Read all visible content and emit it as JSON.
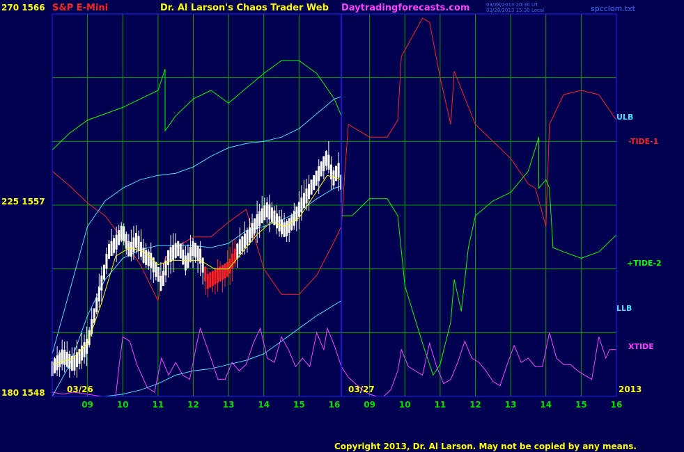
{
  "header": {
    "symbol": "S&P E-Mini",
    "title": "Dr. Al Larson's Chaos Trader Web",
    "site": "Daytradingforecasts.com",
    "stamp1": "03/28/2013 20:30 UT",
    "stamp2": "03/28/2013 15:30 Local",
    "file": "spcclom.txt"
  },
  "copyright": "Copyright 2013, Dr. Al Larson. May not be copied by any means.",
  "colors": {
    "background": "#000050",
    "grid": "#00a000",
    "frame": "#2020ff",
    "tide1": "#ff2020",
    "tide2": "#00ff00",
    "bands": "#40e0ff",
    "xtide": "#ff40ff",
    "price": "#ffffff",
    "ema": "#ffff00"
  },
  "chart_data": {
    "type": "line",
    "y_left_labels": [
      {
        "text": "270  1566",
        "value": 1566
      },
      {
        "text": "225  1557",
        "value": 1557
      },
      {
        "text": "180  1548",
        "value": 1548
      }
    ],
    "ylim": [
      1548,
      1566
    ],
    "x_ticks": [
      "09",
      "10",
      "11",
      "12",
      "13",
      "14",
      "15",
      "16",
      "09",
      "10",
      "11",
      "12",
      "13",
      "14",
      "15",
      "16"
    ],
    "date_labels": [
      "03/26",
      "03/27",
      "2013"
    ],
    "series_labels": [
      {
        "key": "ulb",
        "text": "ULB"
      },
      {
        "key": "tide1",
        "text": "-TIDE-1"
      },
      {
        "key": "tide2",
        "text": "+TIDE-2"
      },
      {
        "key": "llb",
        "text": "LLB"
      },
      {
        "key": "xtide",
        "text": "XTIDE"
      }
    ],
    "series": [
      {
        "key": "tide1",
        "name": "-TIDE-1",
        "color": "#ff2020",
        "points": [
          [
            8.0,
            1558.6
          ],
          [
            8.5,
            1557.9
          ],
          [
            9.0,
            1557.1
          ],
          [
            9.5,
            1556.5
          ],
          [
            10.0,
            1555.4
          ],
          [
            10.5,
            1554.2
          ],
          [
            11.0,
            1552.5
          ],
          [
            11.2,
            1554.5
          ],
          [
            11.5,
            1555.0
          ],
          [
            12.0,
            1555.5
          ],
          [
            12.5,
            1555.5
          ],
          [
            13.0,
            1556.2
          ],
          [
            13.5,
            1556.8
          ],
          [
            14.0,
            1554.0
          ],
          [
            14.5,
            1552.8
          ],
          [
            15.0,
            1552.8
          ],
          [
            15.5,
            1553.7
          ],
          [
            16.0,
            1555.3
          ],
          [
            16.2,
            1556.0
          ],
          [
            16.3,
            1558.6
          ],
          [
            16.4,
            1560.8
          ],
          [
            17.0,
            1560.2
          ],
          [
            17.5,
            1560.2
          ],
          [
            17.8,
            1561.0
          ],
          [
            17.9,
            1564.0
          ],
          [
            18.5,
            1565.8
          ],
          [
            18.7,
            1565.6
          ],
          [
            19.0,
            1563.0
          ],
          [
            19.3,
            1560.8
          ],
          [
            19.4,
            1563.3
          ],
          [
            20.0,
            1560.8
          ],
          [
            21.0,
            1559.2
          ],
          [
            21.5,
            1558.0
          ],
          [
            21.7,
            1557.8
          ],
          [
            22.0,
            1556.0
          ],
          [
            22.1,
            1560.8
          ],
          [
            22.5,
            1562.2
          ],
          [
            23.0,
            1562.4
          ],
          [
            23.5,
            1562.2
          ],
          [
            24.0,
            1561.0
          ]
        ]
      },
      {
        "key": "tide2",
        "name": "+TIDE-2",
        "color": "#00ff00",
        "points": [
          [
            8.0,
            1559.6
          ],
          [
            8.5,
            1560.4
          ],
          [
            9.0,
            1561.0
          ],
          [
            10.0,
            1561.6
          ],
          [
            11.0,
            1562.4
          ],
          [
            11.2,
            1563.4
          ],
          [
            11.2,
            1560.5
          ],
          [
            11.5,
            1561.2
          ],
          [
            12.0,
            1562.0
          ],
          [
            12.5,
            1562.4
          ],
          [
            13.0,
            1561.8
          ],
          [
            13.5,
            1562.5
          ],
          [
            14.0,
            1563.2
          ],
          [
            14.5,
            1563.8
          ],
          [
            15.0,
            1563.8
          ],
          [
            15.5,
            1563.2
          ],
          [
            16.0,
            1562.0
          ],
          [
            16.2,
            1561.2
          ],
          [
            16.2,
            1556.5
          ],
          [
            16.5,
            1556.5
          ],
          [
            17.0,
            1557.3
          ],
          [
            17.5,
            1557.3
          ],
          [
            17.8,
            1556.5
          ],
          [
            18.0,
            1553.2
          ],
          [
            18.5,
            1550.5
          ],
          [
            18.8,
            1549.0
          ],
          [
            19.0,
            1549.5
          ],
          [
            19.3,
            1551.5
          ],
          [
            19.4,
            1553.5
          ],
          [
            19.6,
            1552.0
          ],
          [
            19.8,
            1555.0
          ],
          [
            20.0,
            1556.5
          ],
          [
            20.5,
            1557.2
          ],
          [
            21.0,
            1557.6
          ],
          [
            21.5,
            1558.6
          ],
          [
            21.8,
            1560.2
          ],
          [
            21.8,
            1557.8
          ],
          [
            22.0,
            1558.2
          ],
          [
            22.1,
            1557.8
          ],
          [
            22.2,
            1555.0
          ],
          [
            22.5,
            1554.8
          ],
          [
            23.0,
            1554.5
          ],
          [
            23.5,
            1554.8
          ],
          [
            24.0,
            1555.6
          ]
        ]
      },
      {
        "key": "ulb",
        "name": "ULB",
        "color": "#40e0ff",
        "points": [
          [
            8.0,
            1550.0
          ],
          [
            8.5,
            1553.0
          ],
          [
            9.0,
            1556.0
          ],
          [
            9.5,
            1557.2
          ],
          [
            10.0,
            1557.8
          ],
          [
            10.5,
            1558.2
          ],
          [
            11.0,
            1558.4
          ],
          [
            11.5,
            1558.5
          ],
          [
            12.0,
            1558.8
          ],
          [
            12.5,
            1559.3
          ],
          [
            13.0,
            1559.7
          ],
          [
            13.5,
            1559.9
          ],
          [
            14.0,
            1560.0
          ],
          [
            14.5,
            1560.2
          ],
          [
            15.0,
            1560.6
          ],
          [
            15.5,
            1561.3
          ],
          [
            16.0,
            1562.0
          ],
          [
            16.2,
            1562.1
          ]
        ]
      },
      {
        "key": "mid",
        "name": "",
        "color": "#40e0ff",
        "points": [
          [
            8.0,
            1548.0
          ],
          [
            8.5,
            1549.5
          ],
          [
            9.0,
            1551.8
          ],
          [
            9.5,
            1553.5
          ],
          [
            10.0,
            1554.5
          ],
          [
            10.5,
            1554.9
          ],
          [
            11.0,
            1555.1
          ],
          [
            11.5,
            1555.1
          ],
          [
            12.0,
            1555.1
          ],
          [
            12.5,
            1555.0
          ],
          [
            13.0,
            1555.2
          ],
          [
            13.5,
            1555.8
          ],
          [
            14.0,
            1556.0
          ],
          [
            14.5,
            1556.3
          ],
          [
            15.0,
            1556.7
          ],
          [
            15.5,
            1557.3
          ],
          [
            16.0,
            1557.8
          ],
          [
            16.2,
            1557.9
          ]
        ]
      },
      {
        "key": "llb",
        "name": "LLB",
        "color": "#40e0ff",
        "points": [
          [
            8.0,
            1548.0
          ],
          [
            8.5,
            1548.0
          ],
          [
            9.0,
            1548.0
          ],
          [
            9.5,
            1548.0
          ],
          [
            10.0,
            1548.1
          ],
          [
            10.5,
            1548.3
          ],
          [
            11.0,
            1548.6
          ],
          [
            11.5,
            1549.0
          ],
          [
            12.0,
            1549.2
          ],
          [
            12.5,
            1549.3
          ],
          [
            13.0,
            1549.5
          ],
          [
            13.5,
            1549.7
          ],
          [
            14.0,
            1550.0
          ],
          [
            14.5,
            1550.6
          ],
          [
            15.0,
            1551.2
          ],
          [
            15.5,
            1551.8
          ],
          [
            16.0,
            1552.3
          ],
          [
            16.2,
            1552.5
          ]
        ]
      },
      {
        "key": "xtide",
        "name": "XTIDE",
        "color": "#ff40ff",
        "points": [
          [
            8.0,
            1548.2
          ],
          [
            8.3,
            1548.1
          ],
          [
            8.6,
            1548.2
          ],
          [
            9.0,
            1548.1
          ],
          [
            9.4,
            1548.0
          ],
          [
            9.8,
            1548.0
          ],
          [
            9.9,
            1549.5
          ],
          [
            10.0,
            1550.8
          ],
          [
            10.2,
            1550.6
          ],
          [
            10.4,
            1549.5
          ],
          [
            10.7,
            1548.4
          ],
          [
            10.9,
            1548.2
          ],
          [
            11.1,
            1549.8
          ],
          [
            11.3,
            1549.0
          ],
          [
            11.5,
            1549.6
          ],
          [
            11.7,
            1549.0
          ],
          [
            11.9,
            1548.8
          ],
          [
            12.1,
            1550.5
          ],
          [
            12.2,
            1551.2
          ],
          [
            12.5,
            1549.8
          ],
          [
            12.7,
            1548.8
          ],
          [
            12.9,
            1548.8
          ],
          [
            13.1,
            1549.6
          ],
          [
            13.3,
            1549.2
          ],
          [
            13.5,
            1549.5
          ],
          [
            13.7,
            1550.5
          ],
          [
            13.9,
            1551.2
          ],
          [
            14.1,
            1549.8
          ],
          [
            14.3,
            1549.6
          ],
          [
            14.5,
            1550.8
          ],
          [
            14.7,
            1550.2
          ],
          [
            14.9,
            1549.4
          ],
          [
            15.1,
            1549.8
          ],
          [
            15.3,
            1549.4
          ],
          [
            15.5,
            1551.0
          ],
          [
            15.7,
            1550.2
          ],
          [
            15.8,
            1551.2
          ],
          [
            16.0,
            1550.4
          ],
          [
            16.2,
            1549.4
          ],
          [
            16.4,
            1548.9
          ],
          [
            16.6,
            1548.6
          ],
          [
            16.8,
            1548.3
          ],
          [
            17.0,
            1548.1
          ],
          [
            17.2,
            1548.0
          ],
          [
            17.4,
            1548.0
          ],
          [
            17.6,
            1548.3
          ],
          [
            17.8,
            1549.2
          ],
          [
            17.9,
            1550.2
          ],
          [
            18.1,
            1549.4
          ],
          [
            18.3,
            1549.2
          ],
          [
            18.5,
            1549.0
          ],
          [
            18.7,
            1550.5
          ],
          [
            18.9,
            1549.4
          ],
          [
            19.1,
            1548.6
          ],
          [
            19.3,
            1548.8
          ],
          [
            19.5,
            1549.6
          ],
          [
            19.7,
            1550.6
          ],
          [
            19.9,
            1549.8
          ],
          [
            20.1,
            1549.6
          ],
          [
            20.3,
            1549.2
          ],
          [
            20.5,
            1548.7
          ],
          [
            20.7,
            1548.5
          ],
          [
            20.9,
            1549.5
          ],
          [
            21.1,
            1550.4
          ],
          [
            21.3,
            1549.6
          ],
          [
            21.5,
            1549.8
          ],
          [
            21.7,
            1549.4
          ],
          [
            21.9,
            1549.4
          ],
          [
            22.1,
            1551.0
          ],
          [
            22.3,
            1549.8
          ],
          [
            22.5,
            1549.5
          ],
          [
            22.7,
            1549.5
          ],
          [
            22.9,
            1549.2
          ],
          [
            23.1,
            1549.0
          ],
          [
            23.3,
            1548.8
          ],
          [
            23.5,
            1550.8
          ],
          [
            23.7,
            1549.8
          ],
          [
            23.8,
            1550.2
          ],
          [
            24.0,
            1550.2
          ]
        ]
      }
    ],
    "price_path": [
      [
        8.0,
        1549.3
      ],
      [
        8.3,
        1549.9
      ],
      [
        8.6,
        1549.5
      ],
      [
        9.0,
        1550.4
      ],
      [
        9.3,
        1552.6
      ],
      [
        9.6,
        1554.8
      ],
      [
        9.8,
        1555.2
      ],
      [
        10.0,
        1555.8
      ],
      [
        10.2,
        1554.8
      ],
      [
        10.4,
        1555.4
      ],
      [
        10.6,
        1554.6
      ],
      [
        10.8,
        1554.4
      ],
      [
        11.0,
        1553.8
      ],
      [
        11.1,
        1553.2
      ],
      [
        11.3,
        1554.6
      ],
      [
        11.6,
        1555.0
      ],
      [
        11.8,
        1554.2
      ],
      [
        12.0,
        1555.0
      ],
      [
        12.2,
        1554.6
      ],
      [
        12.4,
        1553.4
      ],
      [
        12.6,
        1553.6
      ],
      [
        12.8,
        1553.8
      ],
      [
        13.0,
        1554.0
      ],
      [
        13.3,
        1555.0
      ],
      [
        13.6,
        1555.6
      ],
      [
        13.8,
        1556.2
      ],
      [
        14.1,
        1556.8
      ],
      [
        14.3,
        1556.4
      ],
      [
        14.6,
        1555.8
      ],
      [
        14.8,
        1556.2
      ],
      [
        15.0,
        1556.8
      ],
      [
        15.2,
        1557.4
      ],
      [
        15.4,
        1558.0
      ],
      [
        15.6,
        1558.6
      ],
      [
        15.8,
        1559.3
      ],
      [
        15.9,
        1558.6
      ],
      [
        16.0,
        1558.2
      ],
      [
        16.1,
        1558.8
      ],
      [
        16.2,
        1558.0
      ]
    ],
    "price_red_range": [
      12.3,
      13.2
    ],
    "ema_path": [
      [
        8.0,
        1549.5
      ],
      [
        8.6,
        1549.8
      ],
      [
        9.0,
        1550.5
      ],
      [
        9.4,
        1552.4
      ],
      [
        9.8,
        1554.6
      ],
      [
        10.2,
        1555.0
      ],
      [
        10.6,
        1554.8
      ],
      [
        11.0,
        1554.2
      ],
      [
        11.4,
        1554.4
      ],
      [
        11.8,
        1554.4
      ],
      [
        12.2,
        1554.4
      ],
      [
        12.6,
        1554.0
      ],
      [
        13.0,
        1554.0
      ],
      [
        13.4,
        1554.8
      ],
      [
        13.8,
        1555.6
      ],
      [
        14.2,
        1556.2
      ],
      [
        14.6,
        1556.0
      ],
      [
        15.0,
        1556.4
      ],
      [
        15.4,
        1557.4
      ],
      [
        15.8,
        1558.4
      ],
      [
        16.2,
        1558.2
      ]
    ]
  }
}
